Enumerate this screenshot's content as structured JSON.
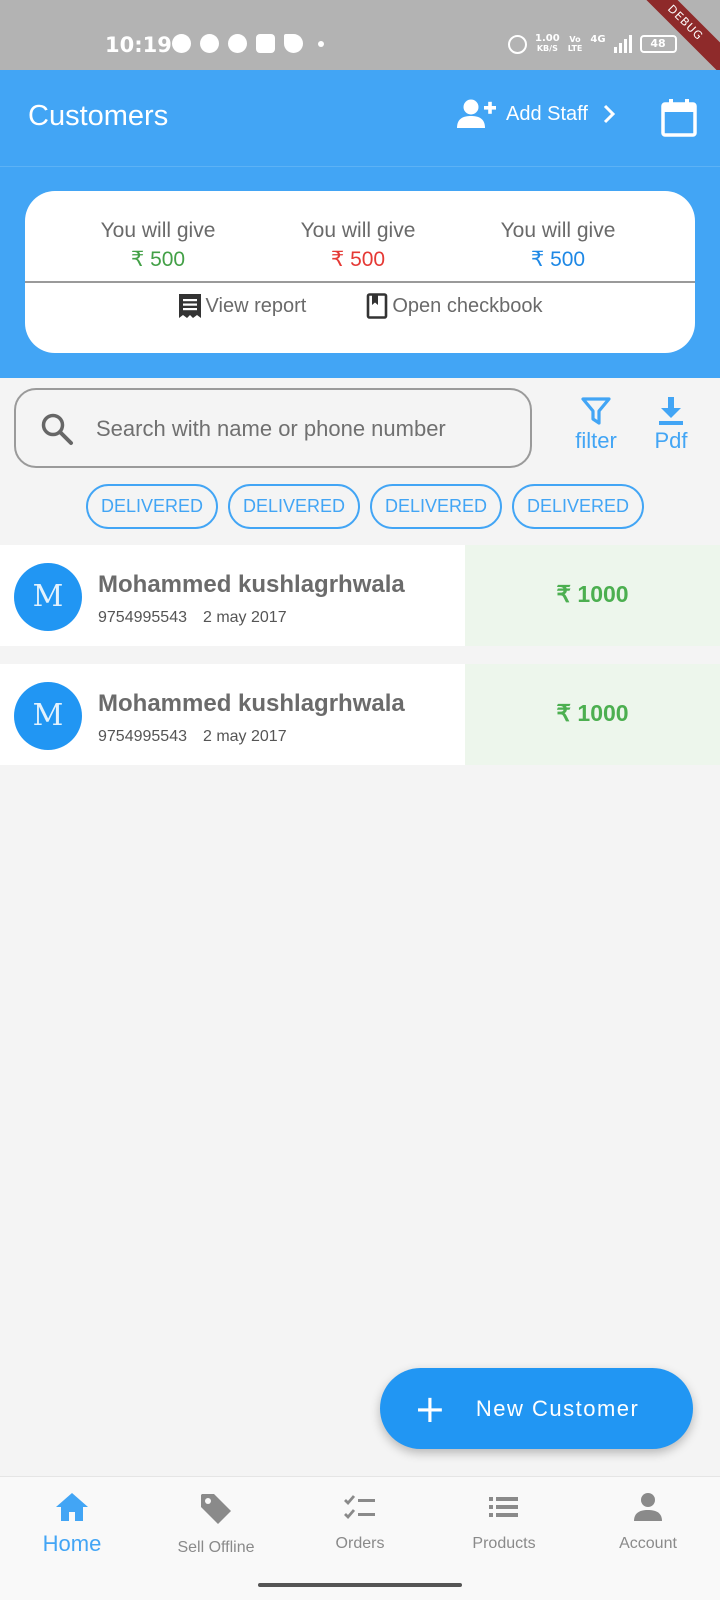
{
  "status_bar": {
    "time": "10:19",
    "net_speed_value": "1.00",
    "net_speed_unit": "KB/S",
    "volte_top": "Vo",
    "volte_bottom": "LTE",
    "network": "4G",
    "battery": "48",
    "debug_banner": "DEBUG"
  },
  "app_bar": {
    "title": "Customers",
    "add_staff_label": "Add Staff"
  },
  "summary": {
    "columns": [
      {
        "label": "You will give",
        "amount": "₹ 500",
        "color": "#43a047"
      },
      {
        "label": "You will give",
        "amount": "₹ 500",
        "color": "#e53935"
      },
      {
        "label": "You will give",
        "amount": "₹ 500",
        "color": "#1e88e5"
      }
    ],
    "view_report_label": "View report",
    "open_checkbook_label": "Open checkbook"
  },
  "search": {
    "placeholder": "Search with name or phone number",
    "value": ""
  },
  "tools": {
    "filter_label": "filter",
    "pdf_label": "Pdf"
  },
  "chips": [
    "DELIVERED",
    "DELIVERED",
    "DELIVERED",
    "DELIVERED"
  ],
  "customers": [
    {
      "initial": "M",
      "name": "Mohammed kushlagrhwala",
      "phone": "9754995543",
      "date": "2 may 2017",
      "amount": "₹ 1000"
    },
    {
      "initial": "M",
      "name": "Mohammed kushlagrhwala",
      "phone": "9754995543",
      "date": "2 may 2017",
      "amount": "₹ 1000"
    }
  ],
  "fab": {
    "label": "New Customer"
  },
  "bottom_nav": [
    {
      "label": "Home",
      "icon": "home-icon",
      "active": true
    },
    {
      "label": "Sell Offline",
      "icon": "tag-icon",
      "active": false
    },
    {
      "label": "Orders",
      "icon": "checklist-icon",
      "active": false
    },
    {
      "label": "Products",
      "icon": "list-icon",
      "active": false
    },
    {
      "label": "Account",
      "icon": "person-icon",
      "active": false
    }
  ],
  "colors": {
    "primary": "#42a5f5",
    "fab": "#2196f3",
    "positive": "#4caf50",
    "amount_cell_bg": "#edf6ec"
  }
}
